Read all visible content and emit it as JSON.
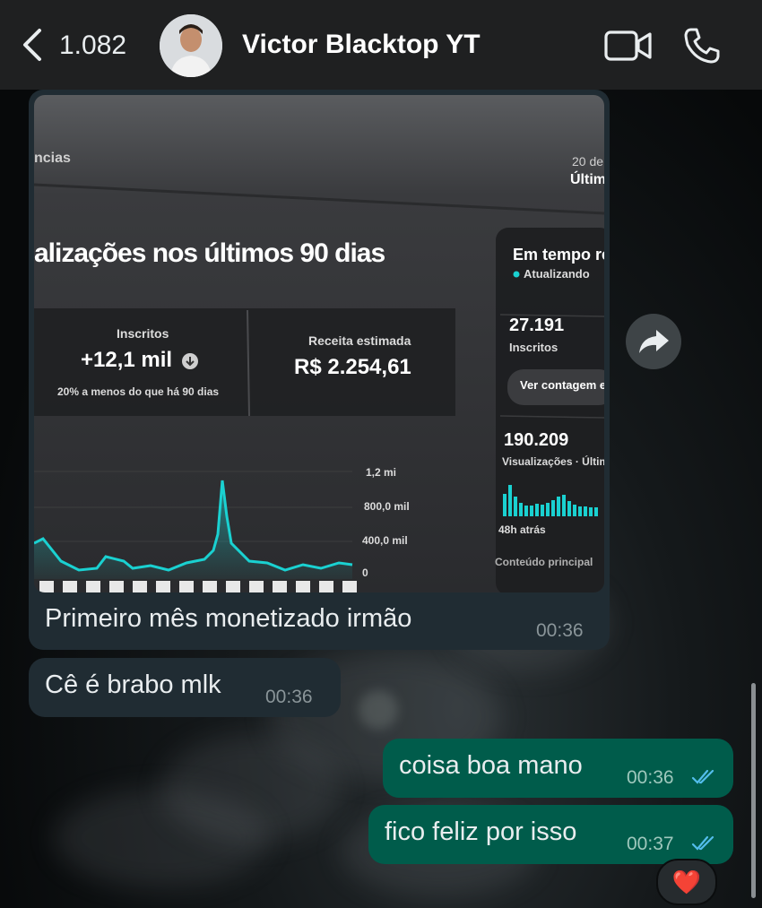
{
  "header": {
    "unread_count": "1.082",
    "contact_name": "Victor Blacktop YT"
  },
  "messages": [
    {
      "type": "image",
      "direction": "incoming",
      "caption": "Primeiro mês monetizado irmão",
      "time": "00:36",
      "photo": {
        "header_left": "ncias",
        "header_right_1": "20 de",
        "header_right_2": "Últim",
        "heading": "alizações nos últimos 90 dias",
        "subs_label": "Inscritos",
        "subs_value": "+12,1 mil",
        "subs_note": "20% a menos do que há 90 dias",
        "revenue_label": "Receita estimada",
        "revenue_value": "R$ 2.254,61",
        "realtime_title": "Em tempo re",
        "realtime_status": "Atualizando",
        "realtime_subs_value": "27.191",
        "realtime_subs_label": "Inscritos",
        "realtime_button": "Ver contagem e",
        "realtime_views_value": "190.209",
        "realtime_views_label": "Visualizações · Últim",
        "realtime_48h": "48h atrás",
        "realtime_top": "Conteúdo principal",
        "axis_ticks": [
          "1,2 mi",
          "800,0 mil",
          "400,0 mil",
          "0"
        ]
      }
    },
    {
      "type": "text",
      "direction": "incoming",
      "text": "Cê é brabo mlk",
      "time": "00:36"
    },
    {
      "type": "text",
      "direction": "outgoing",
      "text": "coisa boa mano",
      "time": "00:36"
    },
    {
      "type": "text",
      "direction": "outgoing",
      "text": "fico feliz por isso",
      "time": "00:37"
    }
  ],
  "reaction": "❤️",
  "colors": {
    "header_bg": "#1f2021",
    "incoming_bubble": "#202c33",
    "outgoing_bubble": "#005c4b",
    "read_tick": "#53bdeb",
    "chart_line": "#1ad1d1"
  }
}
